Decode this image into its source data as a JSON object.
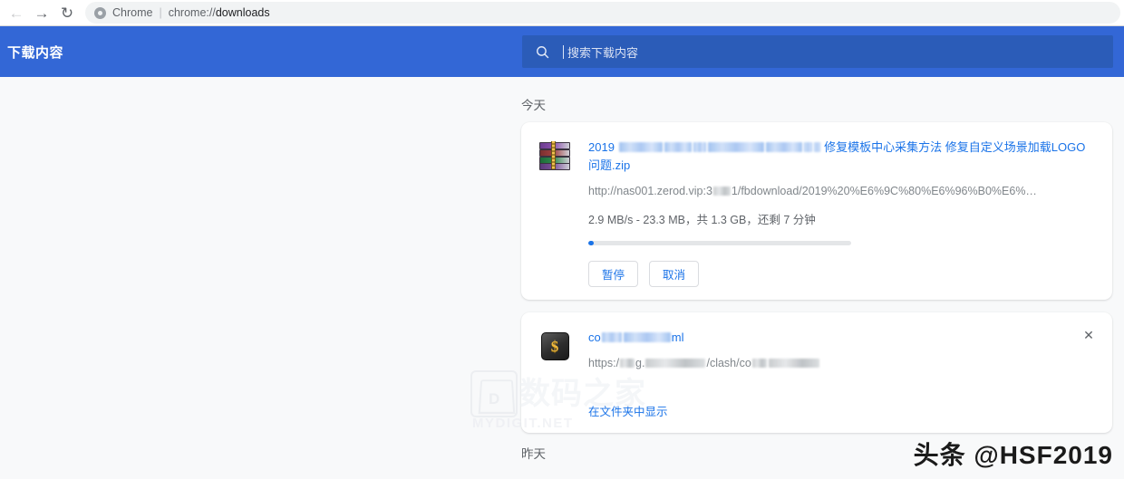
{
  "browser": {
    "back_icon": "arrow-left-icon",
    "forward_icon": "arrow-right-icon",
    "reload_icon": "reload-icon",
    "brand_icon": "chrome-logo-icon",
    "brand_label": "Chrome",
    "separator": "|",
    "url_scheme": "chrome://",
    "url_path": "downloads"
  },
  "toolbar": {
    "title": "下载内容",
    "search_icon": "search-icon",
    "search_value": "",
    "search_placeholder": "搜索下载内容"
  },
  "sections": [
    {
      "date_label": "今天",
      "items": [
        {
          "icon": "winrar-archive-icon",
          "title_prefix": "2019 ",
          "title_suffix": " 修复模板中心采集方法 修复自定义场景加载LOGO问题.zip",
          "url_prefix": "http://nas001.zerod.vip:3",
          "url_suffix": "1/fbdownload/2019%20%E6%9C%80%E6%96%B0%E6%…",
          "status": "2.9 MB/s - 23.3 MB，共 1.3 GB，还剩 7 分钟",
          "progress_percent": 2,
          "pause_label": "暂停",
          "cancel_label": "取消"
        },
        {
          "icon": "script-file-icon",
          "title_prefix": "co",
          "title_suffix": "ml",
          "url_prefix": "https:/",
          "url_mid": "g.",
          "url_suffix": "/clash/co",
          "show_in_folder_label": "在文件夹中显示",
          "close_icon": "close-icon"
        }
      ]
    },
    {
      "date_label": "昨天",
      "items": []
    }
  ],
  "watermarks": {
    "mydigit_letter": "D",
    "mydigit_cn": "数码之家",
    "mydigit_en": "MYDIGIT.NET",
    "toutiao": "头条 @HSF2019"
  },
  "colors": {
    "toolbar_blue": "#3367d6",
    "search_blue": "#2b5cb8",
    "link_blue": "#1a73e8",
    "page_bg": "#f8f9fa"
  }
}
